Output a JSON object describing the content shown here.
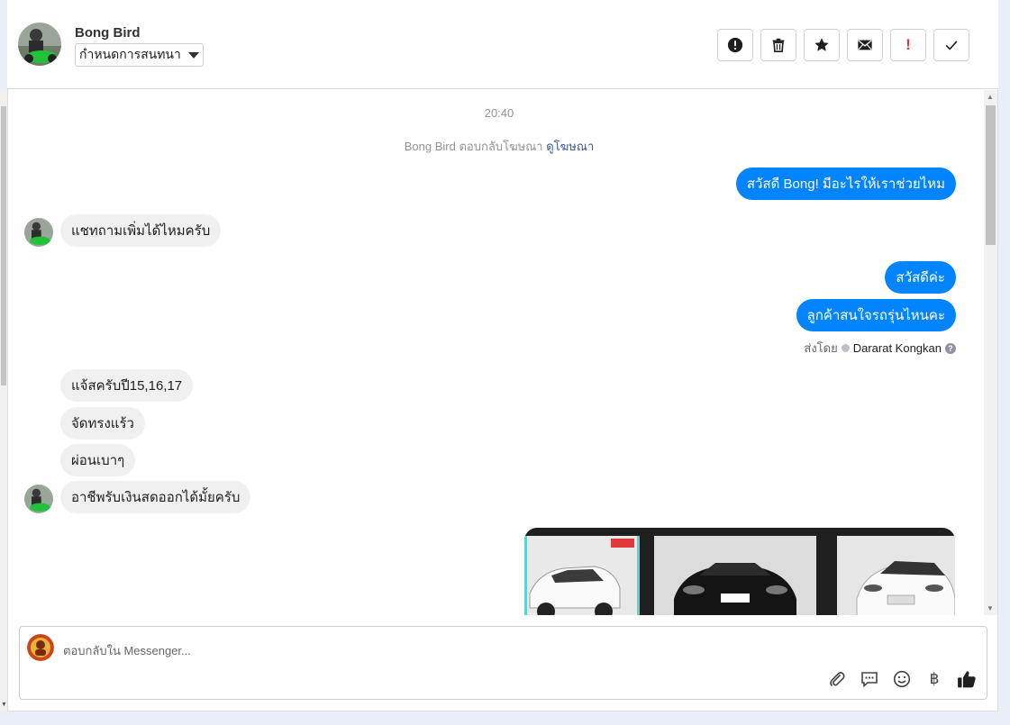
{
  "header": {
    "contact_name": "Bong Bird",
    "assign_label": "กำหนดการสนทนา"
  },
  "conversation": {
    "time": "20:40",
    "ad_note": {
      "text": "Bong Bird ตอบกลับโฆษณา",
      "link": "ดูโฆษณา"
    },
    "messages": [
      {
        "direction": "out",
        "text": "สวัสดี Bong! มีอะไรให้เราช่วยไหม"
      },
      {
        "direction": "in",
        "text": "แชทถามเพิ่มได้ไหมครับ"
      },
      {
        "direction": "out",
        "text": "สวัสดีค่ะ"
      },
      {
        "direction": "out",
        "text": "ลูกค้าสนใจรถรุ่นไหนคะ"
      },
      {
        "direction": "in",
        "text": "แจ้สครับปี15,16,17"
      },
      {
        "direction": "in",
        "text": "จัดทรงแร้ว"
      },
      {
        "direction": "in",
        "text": "ผ่อนเบาๆ"
      },
      {
        "direction": "in",
        "text": "อาชีพรับเงินสดออกได้มั้ยครับ"
      }
    ],
    "sent_by": {
      "prefix": "ส่งโดย",
      "agent": "Dararat Kongkan",
      "help": "?"
    }
  },
  "composer": {
    "placeholder": "ตอบกลับใน Messenger...",
    "tools": [
      "paperclip-icon",
      "saved-reply-icon",
      "emoji-icon",
      "baht-icon",
      "thumbs-up-icon"
    ],
    "baht_symbol": "฿"
  },
  "colors": {
    "outgoing_bubble": "#0084ff",
    "incoming_bubble": "#f1f0f0",
    "link": "#385898",
    "alert_red": "#e4352c"
  }
}
